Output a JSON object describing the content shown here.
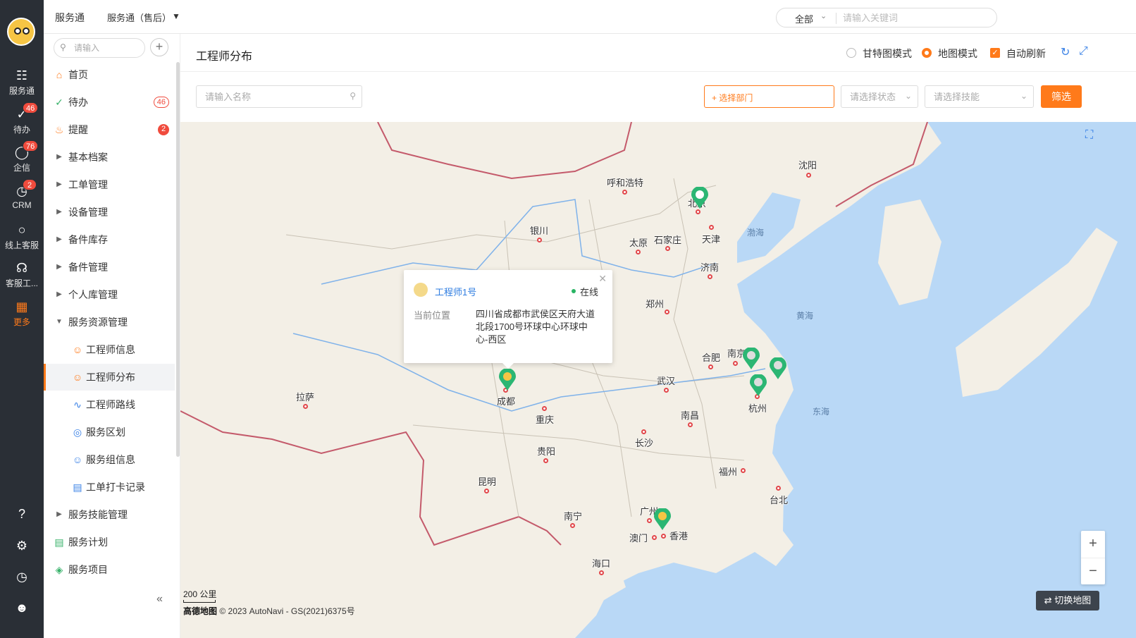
{
  "rail": {
    "items": [
      {
        "label": "服务通",
        "icon": "clipboard-icon"
      },
      {
        "label": "待办",
        "icon": "check-circle-icon",
        "badge": "46"
      },
      {
        "label": "企信",
        "icon": "chat-icon",
        "badge": "76"
      },
      {
        "label": "CRM",
        "icon": "clock-icon",
        "badge": "2"
      },
      {
        "label": "线上客服",
        "icon": "support-chat-icon"
      },
      {
        "label": "客服工...",
        "icon": "headset-icon"
      },
      {
        "label": "更多",
        "icon": "grid-icon"
      }
    ],
    "bottom_icons": [
      "help-icon",
      "settings-icon",
      "history-icon",
      "user-list-icon"
    ]
  },
  "topbar": {
    "app": "服务通",
    "sub": "服务通（售后）",
    "search_scope": "全部",
    "search_placeholder": "请输入关键词"
  },
  "sidebar": {
    "search_placeholder": "请输入",
    "items": [
      {
        "label": "首页",
        "icon": "home-icon"
      },
      {
        "label": "待办",
        "icon": "check-circle-icon",
        "badge": "46"
      },
      {
        "label": "提醒",
        "icon": "bell-icon",
        "badge": "2"
      },
      {
        "label": "基本档案",
        "icon": "caret-right-icon"
      },
      {
        "label": "工单管理",
        "icon": "caret-right-icon"
      },
      {
        "label": "设备管理",
        "icon": "caret-right-icon"
      },
      {
        "label": "备件库存",
        "icon": "caret-right-icon"
      },
      {
        "label": "备件管理",
        "icon": "caret-right-icon"
      },
      {
        "label": "个人库管理",
        "icon": "caret-right-icon"
      },
      {
        "label": "服务资源管理",
        "icon": "caret-down-icon"
      },
      {
        "label": "工程师信息",
        "icon": "engineer-icon"
      },
      {
        "label": "工程师分布",
        "icon": "engineer-map-icon"
      },
      {
        "label": "工程师路线",
        "icon": "route-icon"
      },
      {
        "label": "服务区划",
        "icon": "region-icon"
      },
      {
        "label": "服务组信息",
        "icon": "group-icon"
      },
      {
        "label": "工单打卡记录",
        "icon": "punch-record-icon"
      },
      {
        "label": "服务技能管理",
        "icon": "caret-right-icon"
      },
      {
        "label": "服务计划",
        "icon": "plan-icon"
      },
      {
        "label": "服务项目",
        "icon": "layers-icon"
      }
    ]
  },
  "header": {
    "title": "工程师分布",
    "mode_gantt": "甘特图模式",
    "mode_map": "地图模式",
    "auto_refresh": "自动刷新"
  },
  "filters": {
    "name_placeholder": "请输入名称",
    "dept": "+ 选择部门",
    "status_placeholder": "请选择状态",
    "skill_placeholder": "请选择技能",
    "filter_button": "筛选"
  },
  "map": {
    "cities": [
      "呼和浩特",
      "沈阳",
      "北京",
      "天津",
      "石家庄",
      "太原",
      "银川",
      "济南",
      "郑州",
      "南京",
      "合肥",
      "武汉",
      "杭州",
      "成都",
      "拉萨",
      "重庆",
      "南昌",
      "长沙",
      "贵阳",
      "昆明",
      "福州",
      "台北",
      "广州",
      "南宁",
      "澳门",
      "香港",
      "海口"
    ],
    "seas": [
      "渤海",
      "黄海",
      "东海"
    ],
    "popup": {
      "name": "工程师1号",
      "status": "在线",
      "location_label": "当前位置",
      "location": "四川省成都市武侯区天府大道北段1700号环球中心环球中心-西区"
    },
    "scale": "200 公里",
    "copyright_brand": "高德地图",
    "copyright": "© 2023 AutoNavi - GS(2021)6375号",
    "switch_map": "切换地图",
    "zoom_in": "+",
    "zoom_out": "−"
  },
  "colors": {
    "accent": "#ff7a1a",
    "rail": "#2a2f36",
    "pin": "#2bb673",
    "link": "#2f7de1"
  }
}
